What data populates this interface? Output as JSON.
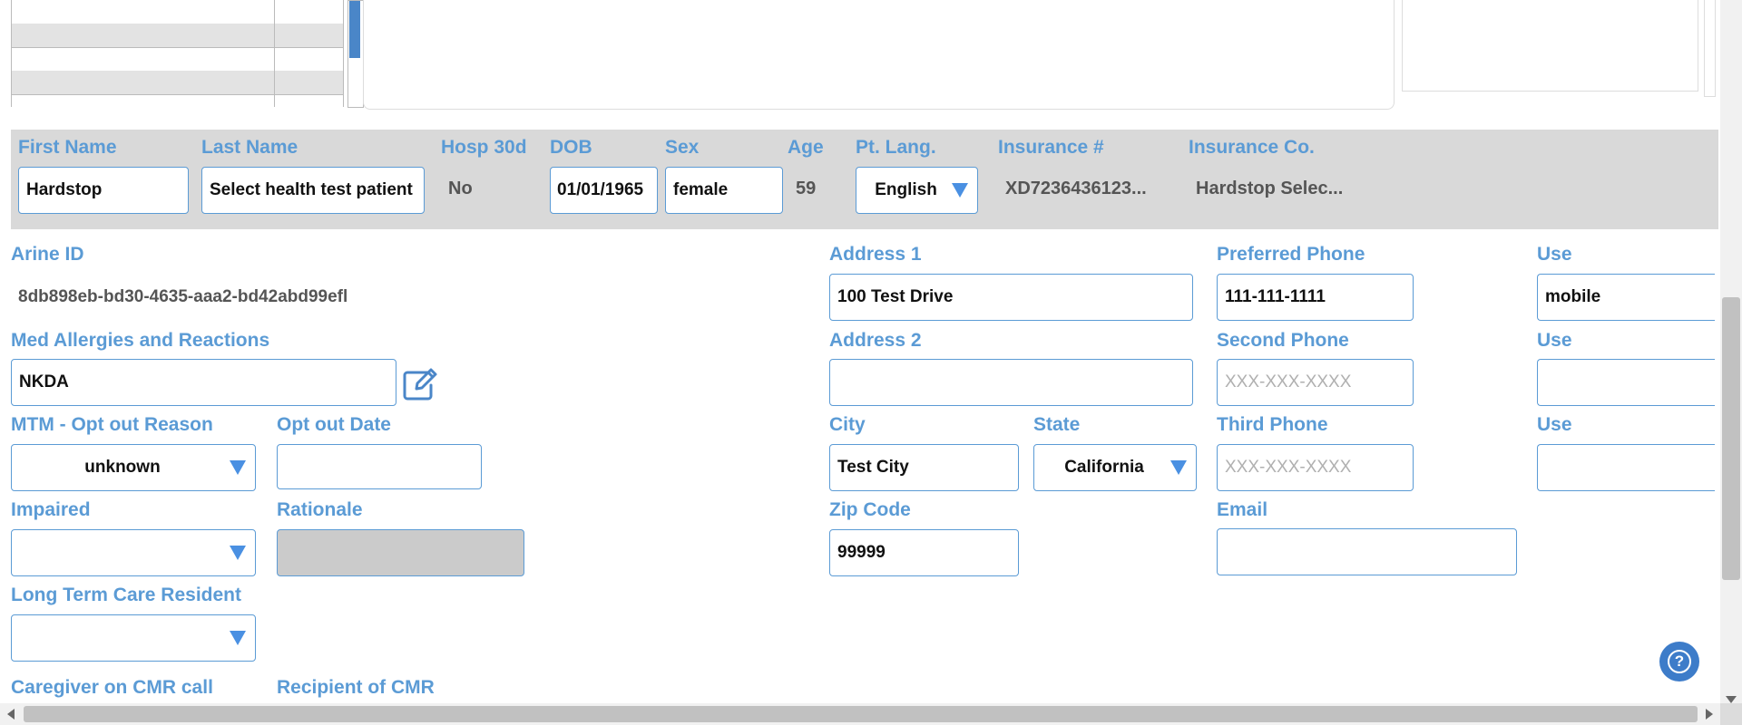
{
  "colors": {
    "accent": "#5b9bd5",
    "band": "#d9d9d9",
    "help": "#3d7cc9"
  },
  "header": {
    "first_name_label": "First Name",
    "first_name_value": "Hardstop",
    "last_name_label": "Last Name",
    "last_name_value": "Select health test patient",
    "hosp_label": "Hosp 30d",
    "hosp_value": "No",
    "dob_label": "DOB",
    "dob_value": "01/01/1965",
    "sex_label": "Sex",
    "sex_value": "female",
    "age_label": "Age",
    "age_value": "59",
    "lang_label": "Pt. Lang.",
    "lang_value": "English",
    "insurance_no_label": "Insurance #",
    "insurance_no_value": "XD7236436123...",
    "insurance_co_label": "Insurance Co.",
    "insurance_co_value": "Hardstop Selec..."
  },
  "left": {
    "arine_id_label": "Arine ID",
    "arine_id_value": "8db898eb-bd30-4635-aaa2-bd42abd99efl",
    "allergies_label": "Med Allergies and Reactions",
    "allergies_value": "NKDA",
    "mtm_label": "MTM - Opt out Reason",
    "mtm_value": "unknown",
    "optout_date_label": "Opt out Date",
    "optout_date_value": "",
    "impaired_label": "Impaired",
    "impaired_value": "",
    "rationale_label": "Rationale",
    "rationale_value": "",
    "ltc_label": "Long Term Care Resident",
    "ltc_value": "",
    "caregiver_label": "Caregiver on CMR call",
    "recipient_label": "Recipient of CMR"
  },
  "address": {
    "address1_label": "Address 1",
    "address1_value": "100 Test Drive",
    "address2_label": "Address 2",
    "address2_value": "",
    "city_label": "City",
    "city_value": "Test City",
    "state_label": "State",
    "state_value": "California",
    "zip_label": "Zip Code",
    "zip_value": "99999"
  },
  "contact": {
    "preferred_phone_label": "Preferred Phone",
    "preferred_phone_value": "111-111-1111",
    "second_phone_label": "Second Phone",
    "second_phone_placeholder": "XXX-XXX-XXXX",
    "third_phone_label": "Third Phone",
    "third_phone_placeholder": "XXX-XXX-XXXX",
    "email_label": "Email",
    "email_value": "",
    "use_label": "Use",
    "use1_value": "mobile",
    "use2_value": "",
    "use3_value": ""
  },
  "help_glyph": "?"
}
